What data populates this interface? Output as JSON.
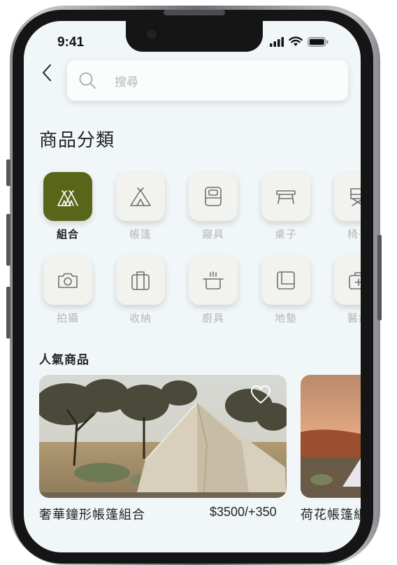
{
  "status_bar": {
    "time": "9:41"
  },
  "search": {
    "placeholder": "搜尋"
  },
  "categories_title": "商品分類",
  "categories": [
    {
      "label": "組合",
      "icon": "tent-group-icon",
      "active": true
    },
    {
      "label": "帳篷",
      "icon": "tent-icon",
      "active": false
    },
    {
      "label": "寢具",
      "icon": "sleeping-bag-icon",
      "active": false
    },
    {
      "label": "桌子",
      "icon": "table-icon",
      "active": false
    },
    {
      "label": "椅子",
      "icon": "chair-icon",
      "active": false
    },
    {
      "label": "拍攝",
      "icon": "camera-icon",
      "active": false
    },
    {
      "label": "收納",
      "icon": "storage-icon",
      "active": false
    },
    {
      "label": "廚具",
      "icon": "cookware-icon",
      "active": false
    },
    {
      "label": "地墊",
      "icon": "mat-icon",
      "active": false
    },
    {
      "label": "醫療",
      "icon": "medical-kit-icon",
      "active": false
    }
  ],
  "popular_title": "人氣商品",
  "products": [
    {
      "name": "奢華鐘形帳篷組合",
      "price": "$3500/+350"
    },
    {
      "name": "荷花帳篷組合"
    }
  ],
  "colors": {
    "accent": "#59661a",
    "background": "#f1f7f8",
    "tile": "#f2f2ef",
    "muted_label": "#b6b6b6"
  }
}
